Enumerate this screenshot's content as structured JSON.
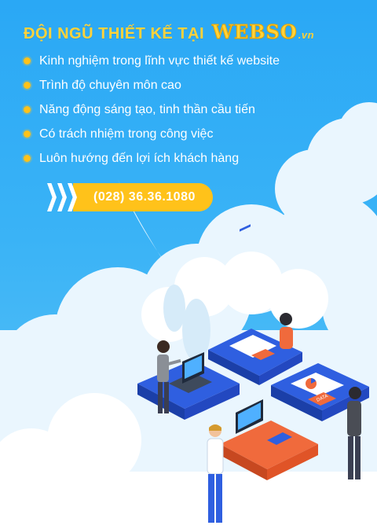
{
  "heading": {
    "title": "ĐỘI NGŨ THIẾT KẾ TẠI",
    "brand": "WEBSO",
    "brand_suffix": ".vn"
  },
  "features": [
    "Kinh nghiệm trong lĩnh vực thiết kế website",
    "Trình độ chuyên môn cao",
    "Năng động sáng tạo, tinh thần cầu tiến",
    "Có trách nhiệm trong công việc",
    "Luôn hướng đến lợi ích khách hàng"
  ],
  "cta": {
    "phone": "(028) 36.36.1080"
  },
  "illustration": {
    "puzzle_card_label": "DATA"
  },
  "colors": {
    "background": "#2aa8f5",
    "accent": "#ffc21a",
    "title": "#ffd23a",
    "puzzle": "#2f5fe0",
    "puzzle_highlight": "#f06a3c"
  },
  "icons": [
    "bullet-dot-icon",
    "chevron-right-icon",
    "team-illustration"
  ]
}
